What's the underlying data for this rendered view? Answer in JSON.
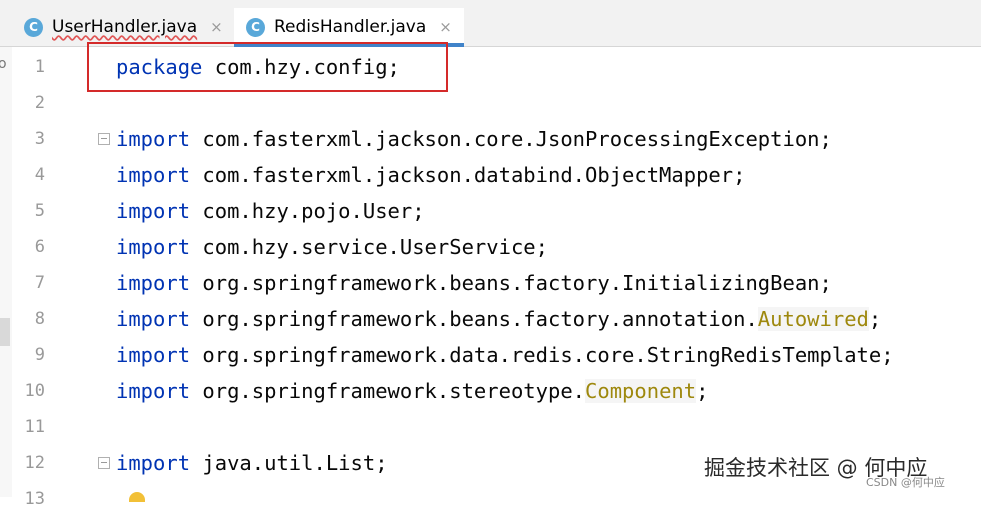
{
  "tabs": [
    {
      "label": "UserHandler.java",
      "icon": "c-class-icon",
      "close": "×",
      "active": false
    },
    {
      "label": "RedisHandler.java",
      "icon": "c-class-icon",
      "close": "×",
      "active": true
    }
  ],
  "class_icon_letter": "C",
  "left_strip_letter": "o",
  "editor": {
    "lines": [
      {
        "num": "1",
        "keyword": "package",
        "text": " com.hzy.config;"
      },
      {
        "num": "2",
        "keyword": "",
        "text": ""
      },
      {
        "num": "3",
        "keyword": "import",
        "text": " com.fasterxml.jackson.core.JsonProcessingException;"
      },
      {
        "num": "4",
        "keyword": "import",
        "text": " com.fasterxml.jackson.databind.ObjectMapper;"
      },
      {
        "num": "5",
        "keyword": "import",
        "text": " com.hzy.pojo.User;"
      },
      {
        "num": "6",
        "keyword": "import",
        "text": " com.hzy.service.UserService;"
      },
      {
        "num": "7",
        "keyword": "import",
        "text": " org.springframework.beans.factory.InitializingBean;"
      },
      {
        "num": "8",
        "keyword": "import",
        "text": " org.springframework.beans.factory.annotation.",
        "ann": "Autowired",
        "tail": ";"
      },
      {
        "num": "9",
        "keyword": "import",
        "text": " org.springframework.data.redis.core.StringRedisTemplate;"
      },
      {
        "num": "10",
        "keyword": "import",
        "text": " org.springframework.stereotype.",
        "ann": "Component",
        "tail": ";"
      },
      {
        "num": "11",
        "keyword": "",
        "text": ""
      },
      {
        "num": "12",
        "keyword": "import",
        "text": " java.util.List;"
      },
      {
        "num": "13",
        "keyword": "",
        "text": ""
      }
    ]
  },
  "watermark": {
    "main": "掘金技术社区 @ 何中应",
    "sub": "CSDN @何中应"
  },
  "colors": {
    "keyword": "#0033b3",
    "annotation": "#9e880d",
    "highlight_box": "#d42a2a",
    "active_tab_underline": "#4083c9"
  }
}
